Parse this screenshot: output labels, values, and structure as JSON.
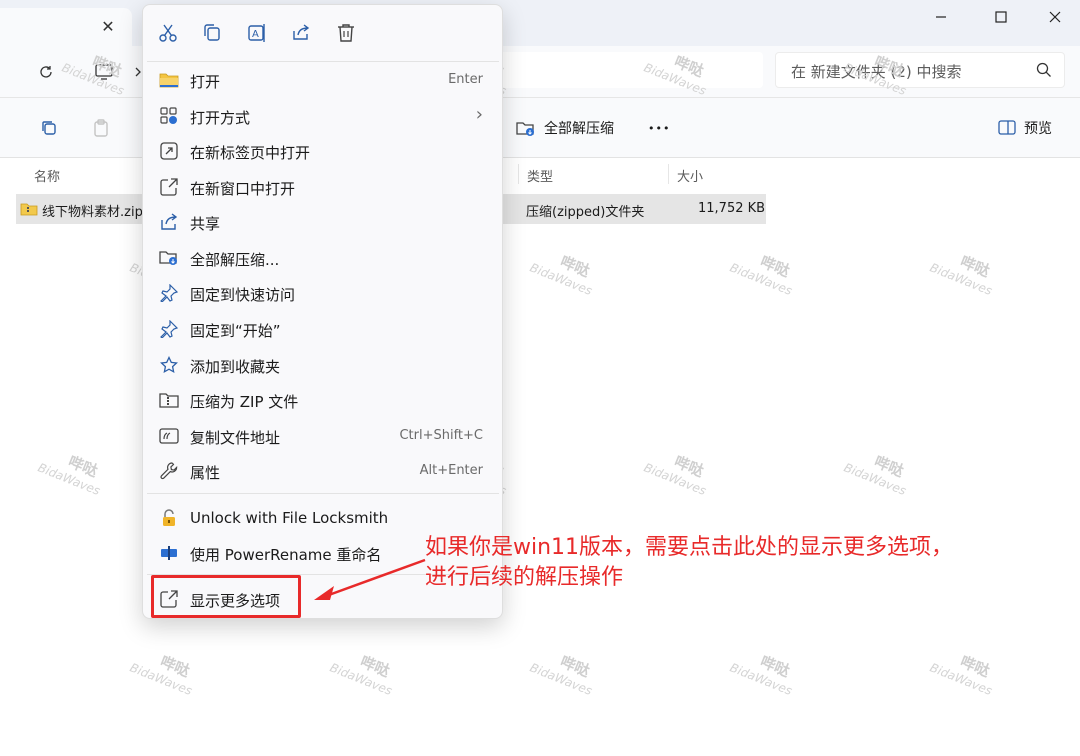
{
  "window": {
    "search_placeholder": "在 新建文件夹 (2) 中搜索"
  },
  "commands": {
    "extract_all": "全部解压缩",
    "more": "•••",
    "preview": "预览"
  },
  "columns": {
    "name": "名称",
    "type": "类型",
    "size": "大小"
  },
  "file": {
    "name": "线下物料素材.zip",
    "type": "压缩(zipped)文件夹",
    "size": "11,752 KB"
  },
  "menu": {
    "quick_icons": [
      "scissors-icon",
      "copy-icon",
      "rename-icon",
      "share-icon",
      "trash-icon"
    ],
    "items": [
      {
        "label": "打开",
        "shortcut": "Enter",
        "icon": "folder-icon"
      },
      {
        "label": "打开方式",
        "shortcut": "›",
        "icon": "open-with-icon"
      },
      {
        "label": "在新标签页中打开",
        "shortcut": "",
        "icon": "new-tab-icon"
      },
      {
        "label": "在新窗口中打开",
        "shortcut": "",
        "icon": "new-window-icon"
      },
      {
        "label": "共享",
        "shortcut": "",
        "icon": "share-icon"
      },
      {
        "label": "全部解压缩...",
        "shortcut": "",
        "icon": "extract-icon"
      },
      {
        "label": "固定到快速访问",
        "shortcut": "",
        "icon": "pin-icon"
      },
      {
        "label": "固定到“开始”",
        "shortcut": "",
        "icon": "pin-start-icon"
      },
      {
        "label": "添加到收藏夹",
        "shortcut": "",
        "icon": "star-icon"
      },
      {
        "label": "压缩为 ZIP 文件",
        "shortcut": "",
        "icon": "zip-icon"
      },
      {
        "label": "复制文件地址",
        "shortcut": "Ctrl+Shift+C",
        "icon": "copy-path-icon"
      },
      {
        "label": "属性",
        "shortcut": "Alt+Enter",
        "icon": "wrench-icon"
      }
    ],
    "extra_items": [
      {
        "label": "Unlock with File Locksmith",
        "icon": "lock-icon"
      },
      {
        "label": "使用 PowerRename 重命名",
        "icon": "power-rename-icon"
      }
    ],
    "show_more": {
      "label": "显示更多选项",
      "icon": "show-more-icon"
    }
  },
  "annotation": {
    "line1": "如果你是win11版本，需要点击此处的显示更多选项，",
    "line2": "进行后续的解压操作"
  },
  "watermark": {
    "cn": "哔哒",
    "en": "BidaWaves"
  },
  "colors": {
    "accent_red": "#e82a2a",
    "icon_blue": "#2c5fa8",
    "selection_gray": "#e5e5e5"
  }
}
